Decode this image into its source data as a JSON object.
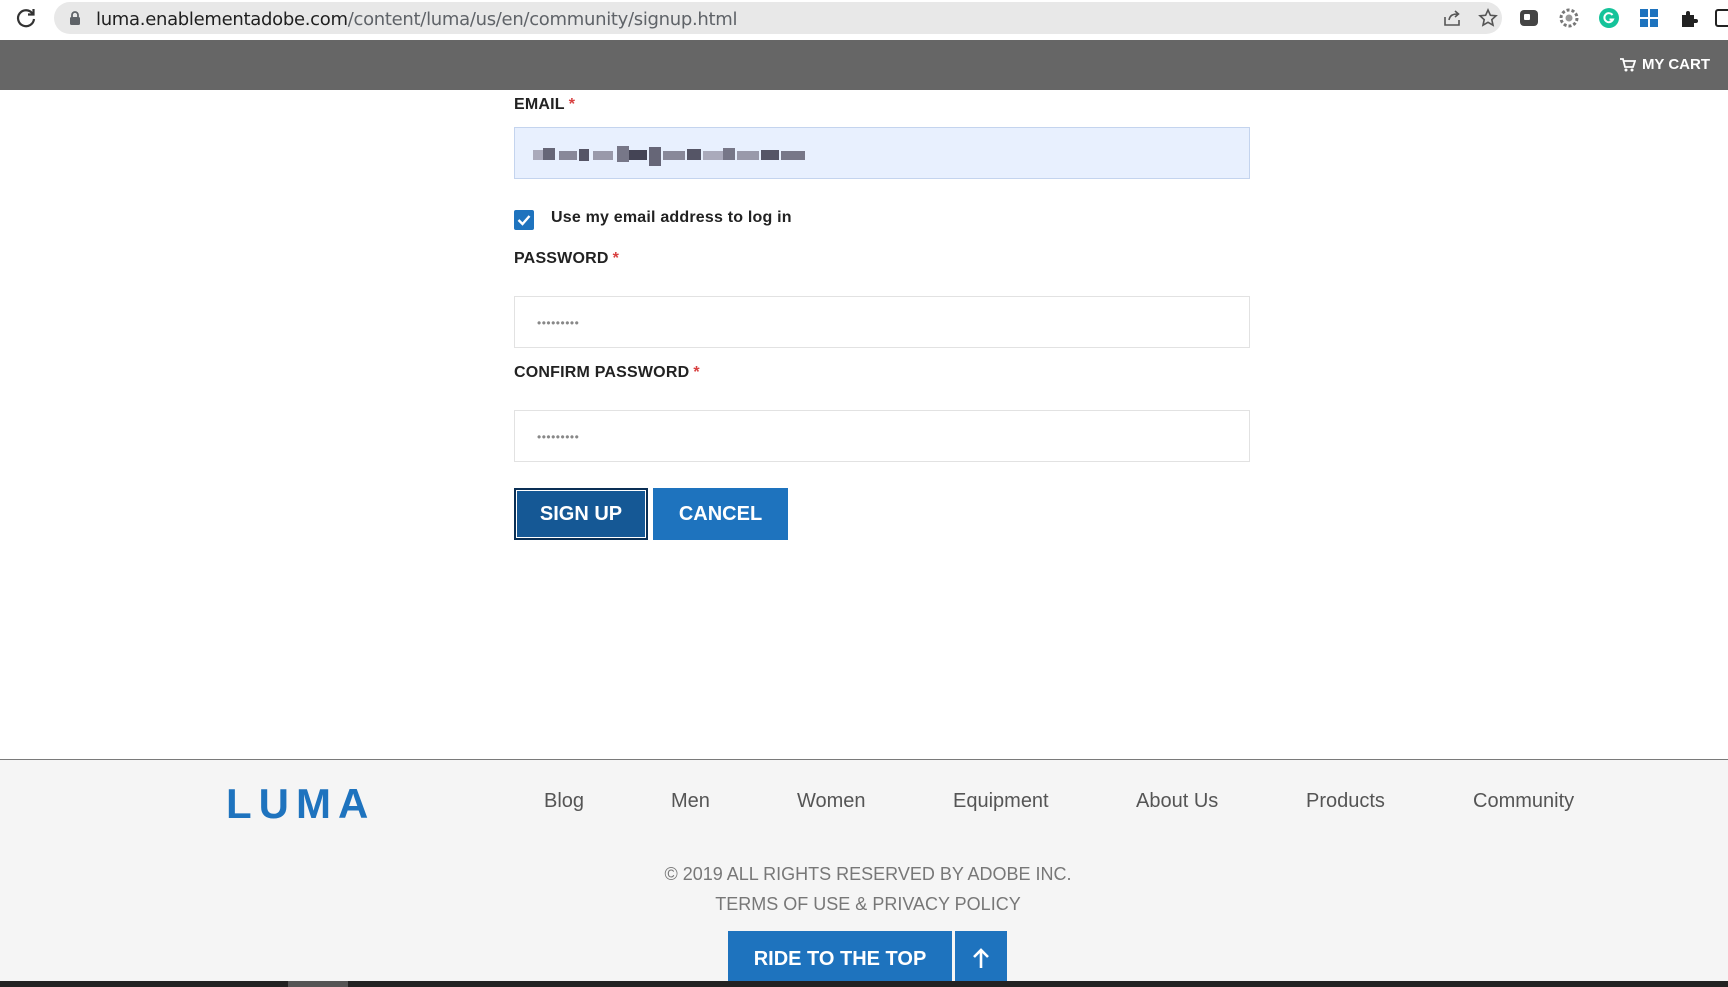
{
  "browser": {
    "url_host": "luma.enablementadobe.com",
    "url_path": "/content/luma/us/en/community/signup.html"
  },
  "header": {
    "cart_label": "MY CART",
    "cart_icon": "cart-icon"
  },
  "form": {
    "email_label": "EMAIL",
    "required_mark": "*",
    "use_email_label": "Use my email address to log in",
    "use_email_checked": true,
    "password_label": "PASSWORD",
    "password_value": "•••••••••",
    "confirm_label": "CONFIRM PASSWORD",
    "confirm_value": "•••••••••",
    "signup_label": "SIGN UP",
    "cancel_label": "CANCEL"
  },
  "footer": {
    "logo": "LUMA",
    "nav": [
      "Blog",
      "Men",
      "Women",
      "Equipment",
      "About Us",
      "Products",
      "Community"
    ],
    "copyright": "© 2019 ALL RIGHTS RESERVED BY ADOBE INC.",
    "terms": "TERMS OF USE & PRIVACY POLICY",
    "ride_label": "RIDE TO THE TOP",
    "ride_icon": "arrow-up-icon"
  },
  "colors": {
    "accent": "#1e73be",
    "header_bg": "#666666",
    "footer_bg": "#f5f5f5",
    "required": "#d84040"
  }
}
